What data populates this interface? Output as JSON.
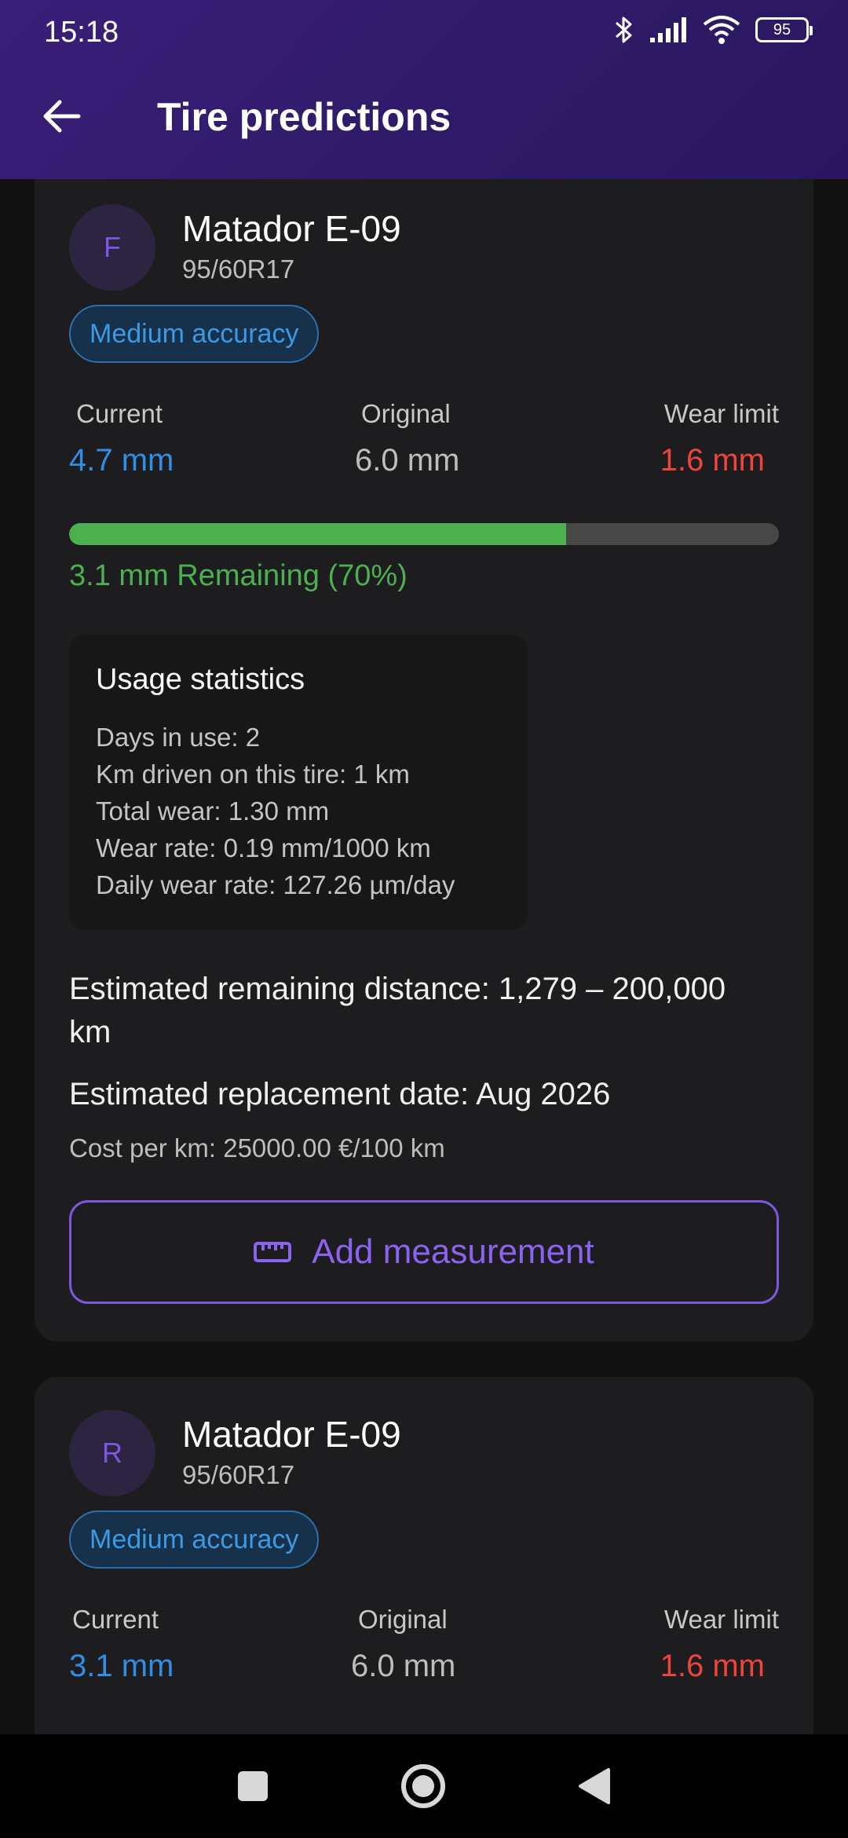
{
  "status": {
    "time": "15:18",
    "battery": "95"
  },
  "header": {
    "title": "Tire predictions"
  },
  "cards": [
    {
      "avatar_letter": "F",
      "name": "Matador E-09",
      "size": "95/60R17",
      "accuracy": "Medium accuracy",
      "labels": {
        "current": "Current",
        "original": "Original",
        "wear_limit": "Wear limit"
      },
      "current": "4.7 mm",
      "original": "6.0 mm",
      "wear_limit": "1.6 mm",
      "remaining_fraction": 0.7,
      "remaining_text": "3.1 mm Remaining (70%)",
      "usage": {
        "title": "Usage statistics",
        "days": "Days in use: 2",
        "km": "Km driven on this tire: 1 km",
        "total_wear": "Total wear: 1.30 mm",
        "wear_rate": "Wear rate: 0.19 mm/1000 km",
        "daily_wear": "Daily wear rate: 127.26 µm/day"
      },
      "est_distance": "Estimated remaining distance: 1,279 – 200,000 km",
      "est_date": "Estimated replacement date: Aug 2026",
      "cost": "Cost per km: 25000.00 €/100 km",
      "add_button": "Add measurement"
    },
    {
      "avatar_letter": "R",
      "name": "Matador E-09",
      "size": "95/60R17",
      "accuracy": "Medium accuracy",
      "labels": {
        "current": "Current",
        "original": "Original",
        "wear_limit": "Wear limit"
      },
      "current": "3.1 mm",
      "original": "6.0 mm",
      "wear_limit": "1.6 mm"
    }
  ],
  "icons": {
    "back": "arrow-left-icon",
    "bluetooth": "bluetooth-icon",
    "signal": "signal-icon",
    "wifi": "wifi-icon",
    "ruler": "ruler-icon",
    "nav_recent": "square-icon",
    "nav_home": "circle-icon",
    "nav_back": "triangle-back-icon"
  },
  "colors": {
    "accent": "#7e57e0",
    "current": "#2f8fe6",
    "limit": "#f0443a",
    "remaining": "#4caf50"
  }
}
